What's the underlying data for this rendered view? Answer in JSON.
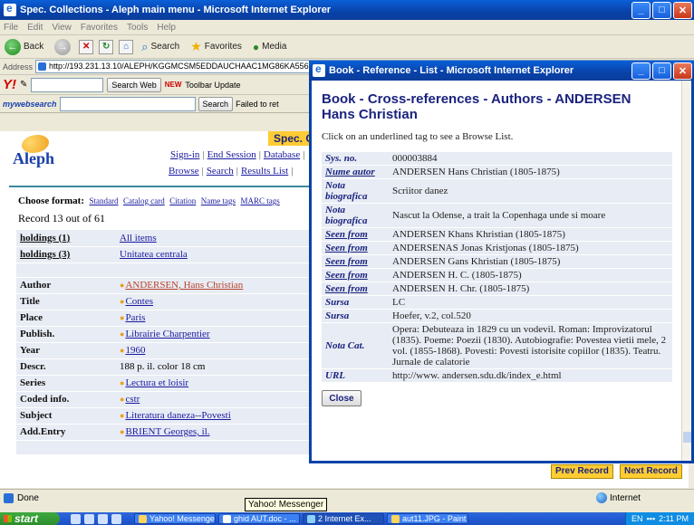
{
  "main_window": {
    "title": "Spec. Collections - Aleph main menu - Microsoft Internet Explorer",
    "menu": [
      "File",
      "Edit",
      "View",
      "Favorites",
      "Tools",
      "Help"
    ],
    "toolbar": {
      "back": "Back",
      "search": "Search",
      "favorites": "Favorites",
      "media": "Media"
    },
    "address_label": "Address",
    "address_value": "http://193.231.13.10/ALEPH/KGGMCSM5EDDAUCHAAC1MG86KA55675N7Q7",
    "yahoo": {
      "search_web": "Search Web",
      "new_badge": "NEW",
      "toolbar_update": "Toolbar Update"
    },
    "mywebsearch": {
      "brand": "mywebsearch",
      "search": "Search",
      "failed": "Failed to ret"
    }
  },
  "page": {
    "logo_text": "Aleph",
    "banner": "Spec. C",
    "nav_top": [
      "Sign-in",
      "End Session",
      "Database"
    ],
    "nav_bottom": [
      "Browse",
      "Search",
      "Results List"
    ],
    "choose_format_label": "Choose format:",
    "formats": [
      "Standard",
      "Catalog card",
      "Citation",
      "Name tags",
      "MARC tags"
    ],
    "record_count": "Record 13 out of 61",
    "holdings": [
      {
        "label": "holdings (1)",
        "value": "All items"
      },
      {
        "label": "holdings (3)",
        "value": "Unitatea centrala"
      }
    ],
    "fields": [
      {
        "label": "Author",
        "value": "ANDERSEN, Hans Christian",
        "link": true,
        "author": true
      },
      {
        "label": "Title",
        "value": "Contes",
        "link": true
      },
      {
        "label": "Place",
        "value": "Paris",
        "link": true
      },
      {
        "label": "Publish.",
        "value": "Librairie Charpentier",
        "link": true
      },
      {
        "label": "Year",
        "value": "1960",
        "link": true
      },
      {
        "label": "Descr.",
        "value": "188 p. il. color 18 cm",
        "link": false
      },
      {
        "label": "Series",
        "value": "Lectura et loisir",
        "link": true
      },
      {
        "label": "Coded info.",
        "value": "cstr",
        "link": true
      },
      {
        "label": "Subject",
        "value": "Literatura daneza--Povesti",
        "link": true
      },
      {
        "label": "Add.Entry",
        "value": "BRIENT Georges, il.",
        "link": true
      }
    ],
    "prev_record": "Prev Record",
    "next_record": "Next Record"
  },
  "popup": {
    "window_title": "Book - Reference - List - Microsoft Internet Explorer",
    "heading": "Book - Cross-references - Authors - ANDERSEN Hans Christian",
    "instruction": "Click on an underlined tag to see a Browse List.",
    "rows": [
      {
        "key": "Sys. no.",
        "value": "000003884",
        "underline": false
      },
      {
        "key": "Nume autor",
        "value": "ANDERSEN Hans Christian (1805-1875)",
        "underline": true
      },
      {
        "key": "Nota biografica",
        "value": "Scriitor danez",
        "underline": false
      },
      {
        "key": "Nota biografica",
        "value": "Nascut la Odense, a trait la Copenhaga unde si moare",
        "underline": false
      },
      {
        "key": "Seen from",
        "value": "ANDERSEN Khans Khristian (1805-1875)",
        "underline": true
      },
      {
        "key": "Seen from",
        "value": "ANDERSENAS Jonas Kristjonas (1805-1875)",
        "underline": true
      },
      {
        "key": "Seen from",
        "value": "ANDERSEN Gans Khristian (1805-1875)",
        "underline": true
      },
      {
        "key": "Seen from",
        "value": "ANDERSEN H. C. (1805-1875)",
        "underline": true
      },
      {
        "key": "Seen from",
        "value": "ANDERSEN H. Chr. (1805-1875)",
        "underline": true
      },
      {
        "key": "Sursa",
        "value": "LC",
        "underline": false
      },
      {
        "key": "Sursa",
        "value": "Hoefer, v.2, col.520",
        "underline": false
      },
      {
        "key": "Nota Cat.",
        "value": "Opera: Debuteaza in 1829 cu un vodevil. Roman: Improvizatorul (1835). Poeme: Poezii (1830). Autobiografie: Povestea vietii mele, 2 vol. (1855-1868). Povesti: Povesti istorisite copiilor (1835). Teatru. Jurnale de calatorie",
        "underline": false
      },
      {
        "key": "URL",
        "value": "http://www. andersen.sdu.dk/index_e.html",
        "underline": false
      }
    ],
    "close_label": "Close"
  },
  "statusbar": {
    "status": "Done",
    "zone": "Internet",
    "tooltip": "Yahoo! Messenger"
  },
  "taskbar": {
    "start": "start",
    "tasks": [
      "Yahoo! Messenger",
      "ghid AUT.doc - ...",
      "2 Internet Ex...",
      "aut11.JPG - Paint"
    ],
    "lang": "EN",
    "clock": "2:11 PM"
  }
}
